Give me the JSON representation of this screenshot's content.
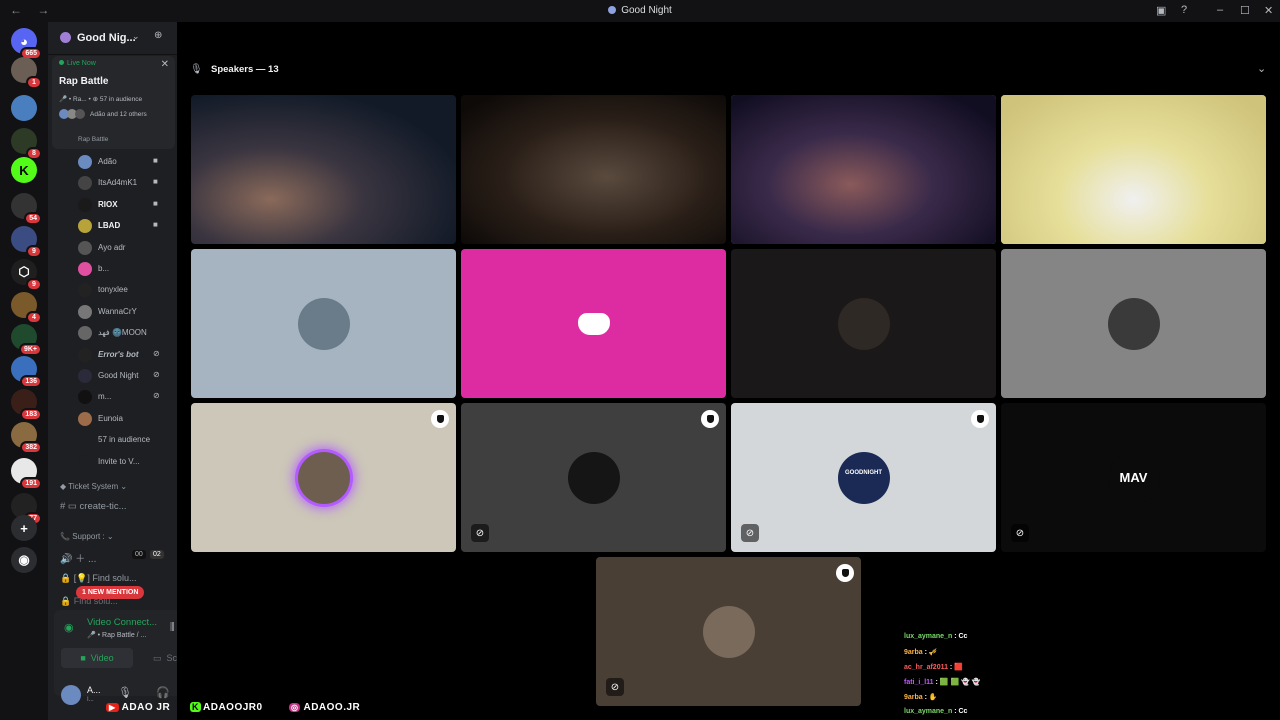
{
  "window": {
    "title": "Good Night",
    "nav": "← →",
    "controls": [
      "▣",
      "?",
      "–",
      "☐",
      "✕"
    ]
  },
  "rail": {
    "servers": [
      {
        "glyph": "◕",
        "badge": "665",
        "color": "#5865f2"
      },
      {
        "glyph": "",
        "badge": "1",
        "color": "#6b5f55"
      },
      {
        "glyph": "",
        "badge": "",
        "color": "#4a7fbf"
      },
      {
        "glyph": "",
        "badge": "8",
        "color": "#2c3a26"
      },
      {
        "glyph": "K",
        "badge": "",
        "color": "#53fc18"
      },
      {
        "glyph": "",
        "badge": "54",
        "color": "#333"
      },
      {
        "glyph": "",
        "badge": "9",
        "color": "#3b4c82"
      },
      {
        "glyph": "⬡",
        "badge": "9",
        "color": "#1f1f1f"
      },
      {
        "glyph": "",
        "badge": "4",
        "color": "#7a5a2a"
      },
      {
        "glyph": "",
        "badge": "9K+",
        "color": "#1f4a2e"
      },
      {
        "glyph": "",
        "badge": "136",
        "color": "#3a6fbd"
      },
      {
        "glyph": "",
        "badge": "183",
        "color": "#3a1f18"
      },
      {
        "glyph": "",
        "badge": "382",
        "color": "#8a6a40"
      },
      {
        "glyph": "",
        "badge": "191",
        "color": "#e8e8e8"
      },
      {
        "glyph": "",
        "badge": "77",
        "color": "#222"
      },
      {
        "glyph": "+",
        "badge": "",
        "color": "#2b2d31"
      },
      {
        "glyph": "◉",
        "badge": "",
        "color": "#2b2d31"
      }
    ]
  },
  "sidebar": {
    "server_name": "Good Nig...",
    "live": {
      "status": "Live Now",
      "title": "Rap Battle",
      "meta": "🎤 • Ra...  • ⊕ 57 in audience",
      "audience": "Adão and 12 others",
      "close": "✕"
    },
    "stage_label": "Rap Battle",
    "members": [
      {
        "name": "Adão",
        "color": "#6b8ac0"
      },
      {
        "name": "ItsAd4mK1",
        "color": "#444"
      },
      {
        "name": "RIOX",
        "color": "#1a1a1a"
      },
      {
        "name": "LBAD",
        "color": "#b8a23a"
      },
      {
        "name": "Ayo adr",
        "color": "#555"
      },
      {
        "name": "b...",
        "color": "#e04fa0"
      },
      {
        "name": "tonyxlee",
        "color": "#222"
      },
      {
        "name": "WannaCrY",
        "color": "#777"
      },
      {
        "name": "فهد 🌚MOON",
        "color": "#666"
      },
      {
        "name": "Error's bot",
        "color": "#222"
      },
      {
        "name": "Good Night",
        "color": "#2a2a3a"
      },
      {
        "name": "m...",
        "color": "#111"
      },
      {
        "name": "Eunoia",
        "color": "#9b6b4a"
      },
      {
        "name": "57 in audience",
        "color": "#1e1f22"
      },
      {
        "name": "Invite to V...",
        "color": "#1e1f22"
      }
    ],
    "categories": {
      "ticket": "Ticket System",
      "create": "create-tic...",
      "support": "Support :",
      "find1": "[💡] Find solu...",
      "find2": "Find solu...",
      "counter_a": "00",
      "counter_b": "02"
    },
    "new_mention": "1 NEW MENTION",
    "voice": {
      "status": "Video Connect...",
      "channel": "🎤 • Rap Battle / ...",
      "video_btn": "Video",
      "screen_btn": "Screen"
    },
    "user": {
      "name": "A...",
      "tag": "I..."
    }
  },
  "main": {
    "header": "Speakers — 13",
    "tiles": [
      {
        "kind": "camera",
        "bg": "#1e2a3a"
      },
      {
        "kind": "camera",
        "bg": "#2a1f18"
      },
      {
        "kind": "camera",
        "bg": "#1c1630",
        "speaking": true
      },
      {
        "kind": "camera",
        "bg": "#e6df9a",
        "speaking": true
      },
      {
        "kind": "avatar",
        "bg": "#a5b4c0",
        "av": "#6a7c8a"
      },
      {
        "kind": "discord",
        "bg": "#dd2ba2"
      },
      {
        "kind": "avatar",
        "bg": "#1a1818",
        "av": "#2f2925"
      },
      {
        "kind": "avatar",
        "bg": "#858585",
        "av": "#3a3a3a"
      },
      {
        "kind": "avatar",
        "bg": "#ccc7b8",
        "av": "#6d5e50",
        "ring": "#b35bff",
        "shield": true
      },
      {
        "kind": "avatar",
        "bg": "#3f3f3f",
        "av": "#151515",
        "shield": true,
        "muted": true
      },
      {
        "kind": "logo",
        "bg": "#d4d7da",
        "av": "#1a2a55",
        "shield": true,
        "muted": true,
        "logo_text": "GOODNIGHT"
      },
      {
        "kind": "logo",
        "bg": "#0b0b0b",
        "av": "#0b0b0b",
        "muted": true,
        "logo_text": "MAV"
      },
      {
        "kind": "avatar",
        "bg": "#4a3f35",
        "av": "#7a6a5c",
        "shield": true,
        "muted": true
      }
    ]
  },
  "chat": [
    {
      "user": "lux_aymane_n",
      "msg": "Cc",
      "color": "#7dd96b"
    },
    {
      "user": "9arba",
      "msg": "🎺",
      "color": "#ffb347"
    },
    {
      "user": "ac_hr_af2011",
      "msg": "🟥",
      "color": "#ff5c5c"
    },
    {
      "user": "fati_i_l11",
      "msg": "🟩 🟩 👻 👻",
      "color": "#c25bff"
    },
    {
      "user": "9arba",
      "msg": "✋",
      "color": "#ffb347"
    },
    {
      "user": "lux_aymane_n",
      "msg": "Cc",
      "color": "#7dd96b"
    }
  ],
  "footer": {
    "youtube": "ADAO JR",
    "kick": "ADAOOJR0",
    "instagram": "ADAOO.JR"
  }
}
